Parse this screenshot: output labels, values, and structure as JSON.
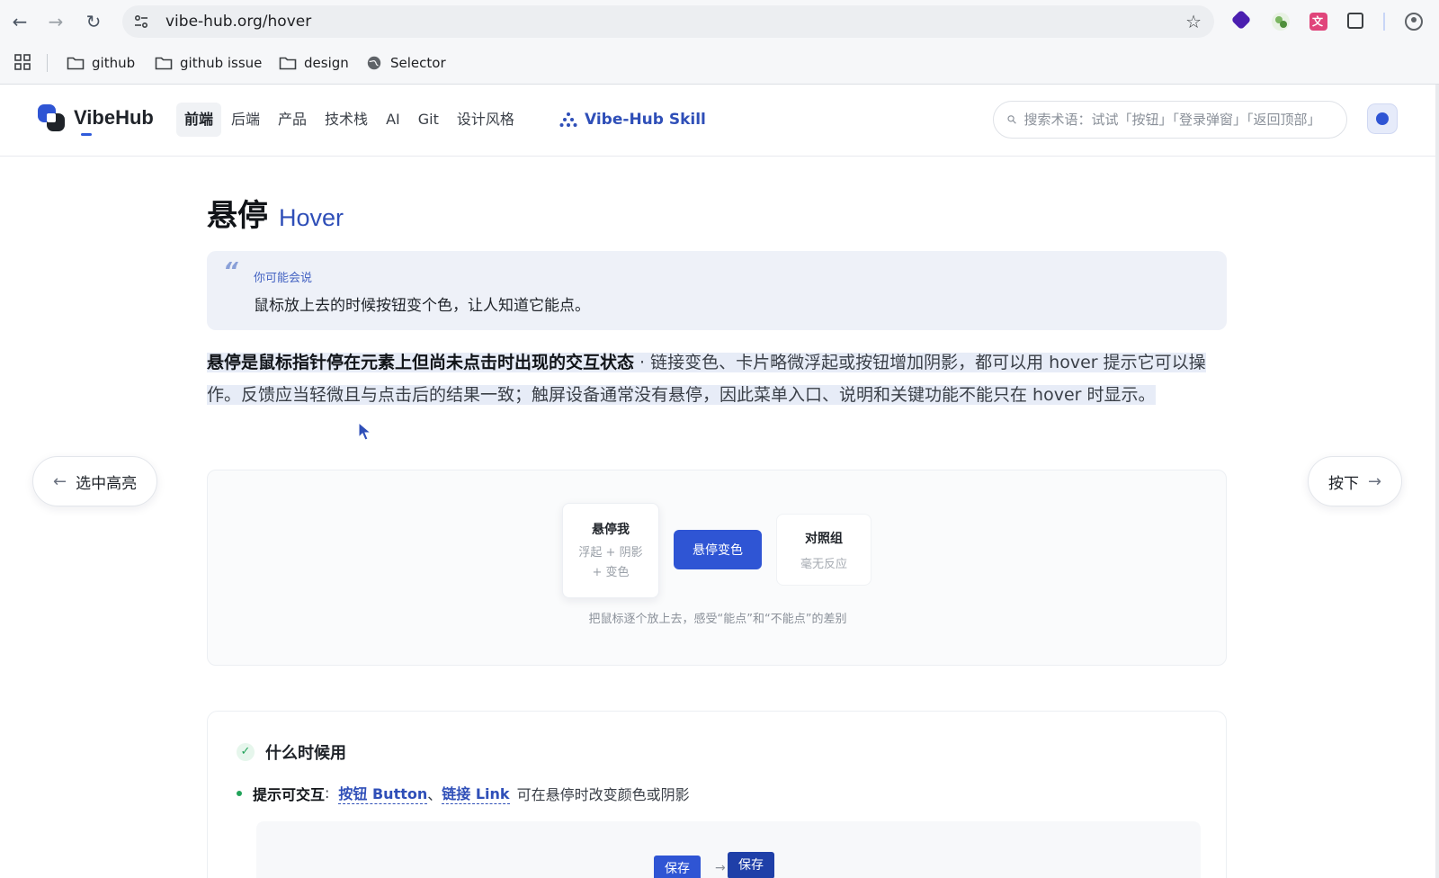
{
  "browser": {
    "url": "vibe-hub.org/hover",
    "bookmarks": [
      {
        "label": "github",
        "icon": "folder-icon"
      },
      {
        "label": "github issue",
        "icon": "folder-icon"
      },
      {
        "label": "design",
        "icon": "folder-icon"
      },
      {
        "label": "Selector",
        "icon": "globe-icon"
      }
    ]
  },
  "header": {
    "logo_text": "VibeHub",
    "nav": [
      "前端",
      "后端",
      "产品",
      "技术栈",
      "AI",
      "Git",
      "设计风格"
    ],
    "active_nav": "前端",
    "skill_label": "Vibe-Hub Skill",
    "search_placeholder": "搜索术语：试试「按钮」「登录弹窗」「返回顶部」"
  },
  "page": {
    "title_zh": "悬停",
    "title_en": "Hover",
    "quote": {
      "label": "你可能会说",
      "text": "鼠标放上去的时候按钮变个色，让人知道它能点。"
    },
    "definition_bold": "悬停是鼠标指针停在元素上但尚未点击时出现的交互状态",
    "definition_rest": "链接变色、卡片略微浮起或按钮增加阴影，都可以用 hover 提示它可以操作。反馈应当轻微且与点击后的结果一致；触屏设备通常没有悬停，因此菜单入口、说明和关键功能不能只在 hover 时显示。",
    "prev_label": "选中高亮",
    "next_label": "按下",
    "demo": {
      "card_title": "悬停我",
      "card_sub_1": "浮起 + 阴影",
      "card_sub_2": "+ 变色",
      "button_label": "悬停变色",
      "control_title": "对照组",
      "control_sub": "毫无反应",
      "caption": "把鼠标逐个放上去，感受“能点”和“不能点”的差别"
    },
    "usage": {
      "title": "什么时候用",
      "item_label": "提示可交互",
      "link_button": "按钮 Button",
      "separator": "、",
      "link_link": "链接 Link",
      "item_text": "可在悬停时改变颜色或阴影",
      "mini_before": "保存",
      "mini_after": "保存"
    }
  },
  "colors": {
    "accent": "#2f55d4",
    "link": "#2f4fb8",
    "success": "#22a35a"
  }
}
